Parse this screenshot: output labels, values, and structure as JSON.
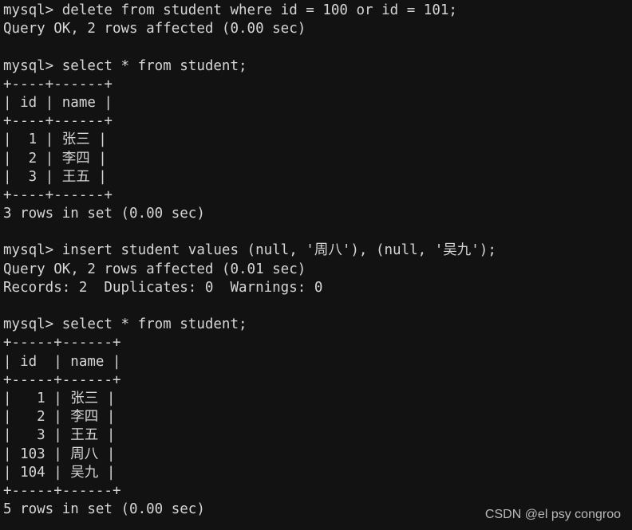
{
  "terminal": {
    "background_color": "#121212",
    "text_color": "#d6d6d6",
    "prompt": "mysql>",
    "lines": [
      "mysql> delete from student where id = 100 or id = 101;",
      "Query OK, 2 rows affected (0.00 sec)",
      "",
      "mysql> select * from student;",
      "+----+------+",
      "| id | name |",
      "+----+------+",
      "|  1 | 张三 |",
      "|  2 | 李四 |",
      "|  3 | 王五 |",
      "+----+------+",
      "3 rows in set (0.00 sec)",
      "",
      "mysql> insert student values (null, '周八'), (null, '吴九');",
      "Query OK, 2 rows affected (0.01 sec)",
      "Records: 2  Duplicates: 0  Warnings: 0",
      "",
      "mysql> select * from student;",
      "+-----+------+",
      "| id  | name |",
      "+-----+------+",
      "|   1 | 张三 |",
      "|   2 | 李四 |",
      "|   3 | 王五 |",
      "| 103 | 周八 |",
      "| 104 | 吴九 |",
      "+-----+------+",
      "5 rows in set (0.00 sec)"
    ],
    "commands": [
      {
        "sql": "delete from student where id = 100 or id = 101;",
        "result": "Query OK, 2 rows affected (0.00 sec)"
      },
      {
        "sql": "select * from student;",
        "result": "3 rows in set (0.00 sec)"
      },
      {
        "sql": "insert student values (null, '周八'), (null, '吴九');",
        "result": "Query OK, 2 rows affected (0.01 sec)",
        "extra": "Records: 2  Duplicates: 0  Warnings: 0"
      },
      {
        "sql": "select * from student;",
        "result": "5 rows in set (0.00 sec)"
      }
    ],
    "tables": [
      {
        "columns": [
          "id",
          "name"
        ],
        "rows": [
          [
            "1",
            "张三"
          ],
          [
            "2",
            "李四"
          ],
          [
            "3",
            "王五"
          ]
        ],
        "row_count_label": "3 rows in set (0.00 sec)"
      },
      {
        "columns": [
          "id",
          "name"
        ],
        "rows": [
          [
            "1",
            "张三"
          ],
          [
            "2",
            "李四"
          ],
          [
            "3",
            "王五"
          ],
          [
            "103",
            "周八"
          ],
          [
            "104",
            "吴九"
          ]
        ],
        "row_count_label": "5 rows in set (0.00 sec)"
      }
    ]
  },
  "watermark": {
    "text": "CSDN @el psy congroo"
  }
}
